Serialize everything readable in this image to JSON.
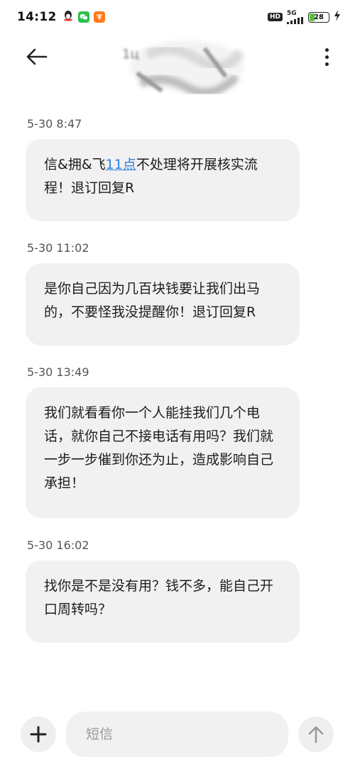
{
  "status_bar": {
    "time": "14:12",
    "network": "5G",
    "hd_label": "HD",
    "battery_level": "28",
    "battery_fraction": 0.28,
    "app_icons": [
      "qq-icon",
      "wechat-icon",
      "taobao-icon"
    ]
  },
  "header": {
    "contact_name_partial": "1ц"
  },
  "messages": [
    {
      "time": "5-30 8:47",
      "text_before": "信&拥&飞",
      "link_text": "11点",
      "text_after": "不处理将开展核实流程！退订回复R"
    },
    {
      "time": "5-30 11:02",
      "text": "是你自己因为几百块钱要让我们出马的，不要怪我没提醒你！退订回复R"
    },
    {
      "time": "5-30 13:49",
      "text": "我们就看看你一个人能挂我们几个电话，就你自己不接电话有用吗？我们就一步一步催到你还为止，造成影响自己承担！"
    },
    {
      "time": "5-30 16:02",
      "text": "找你是不是没有用？钱不多，能自己开口周转吗？"
    }
  ],
  "input": {
    "placeholder": "短信",
    "value": ""
  },
  "colors": {
    "bubble_bg": "#f1f1f1",
    "link": "#2f7fe0",
    "battery_fill": "#58c13b"
  }
}
